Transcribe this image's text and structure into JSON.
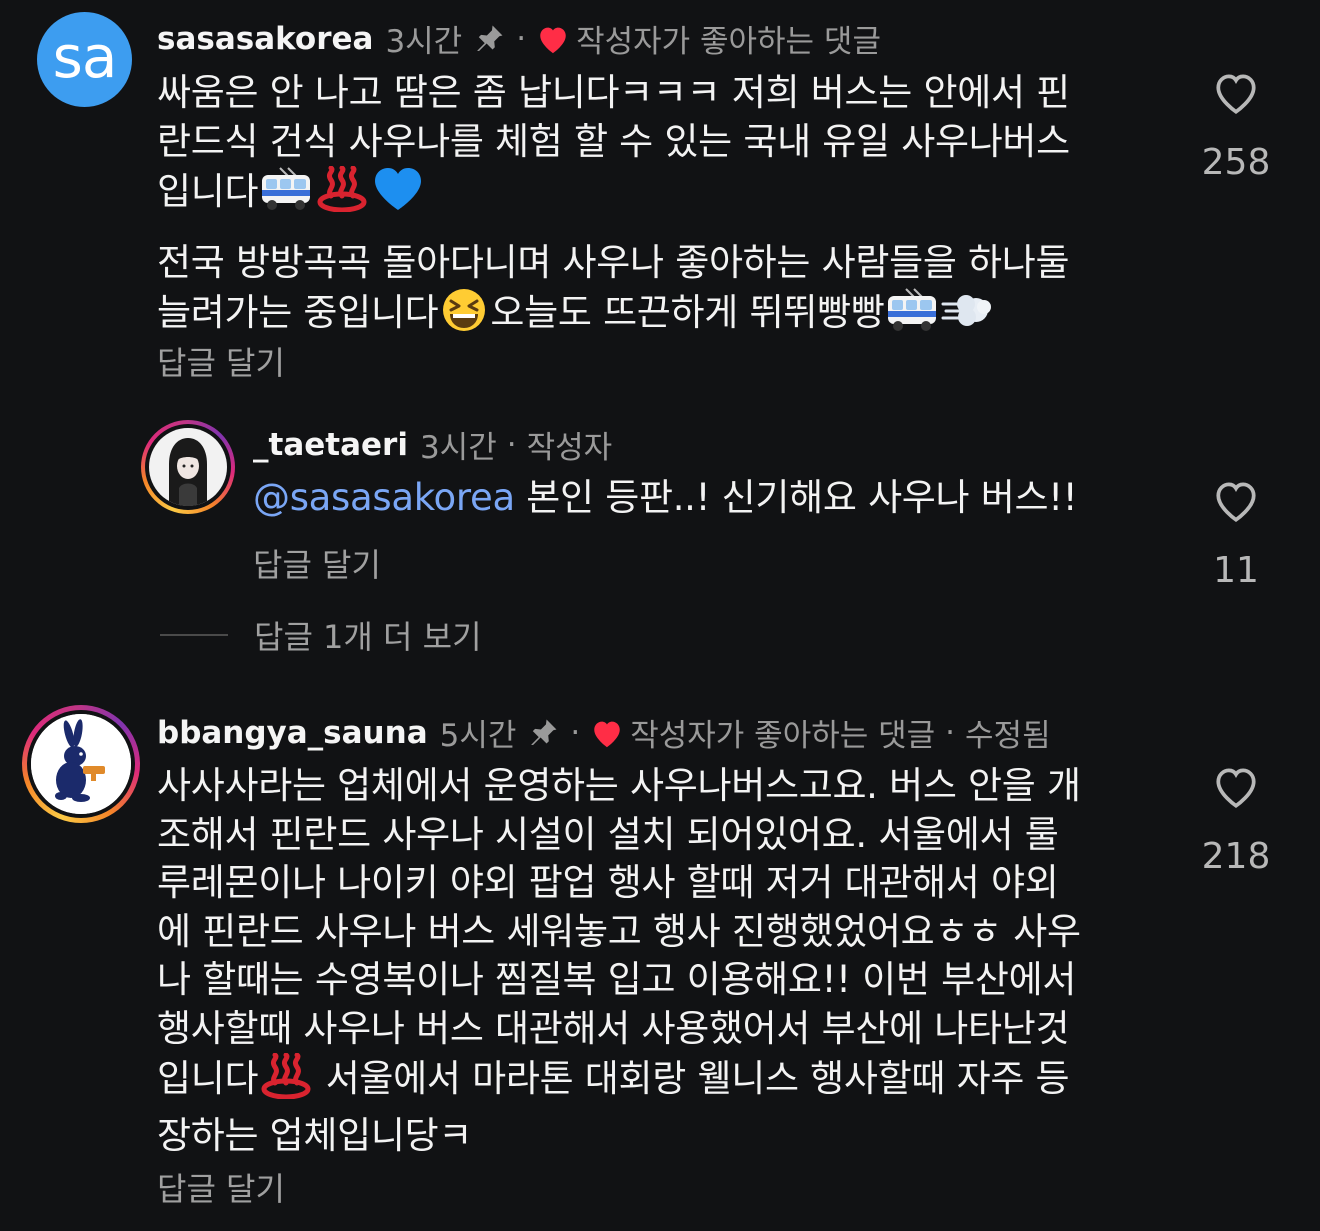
{
  "comments": [
    {
      "username": "sasasakorea",
      "avatar_text": "sa",
      "time": "3시간",
      "pinned": true,
      "liked_label": "작성자가 좋아하는 댓글",
      "edited": "",
      "text_part1": "싸움은 안 나고 땀은 좀 납니다ㅋㅋㅋ 저희 버스는 안에서 핀\n란드식 건식 사우나를 체험 할 수 있는 국내 유일 사우나버스\n입니다",
      "text_part2": "전국 방방곡곡 돌아다니며 사우나 좋아하는 사람들을 하나둘\n늘려가는 중입니다",
      "text_part3": "오늘도 뜨끈하게 뛰뛰빵빵",
      "reply_label": "답글 달기",
      "like_count": "258"
    },
    {
      "username": "_taetaeri",
      "time": "3시간",
      "author_label": "작성자",
      "mention": "@sasasakorea",
      "text": " 본인 등판..! 신기해요 사우나 버스!!",
      "reply_label": "답글 달기",
      "like_count": "11"
    },
    {
      "username": "bbangya_sauna",
      "time": "5시간",
      "pinned": true,
      "liked_label": "작성자가 좋아하는 댓글",
      "edited": "수정됨",
      "text_part1": "사사사라는 업체에서 운영하는 사우나버스고요. 버스 안을 개\n조해서 핀란드 사우나 시설이 설치 되어있어요. 서울에서 룰\n루레몬이나 나이키 야외 팝업 행사 할때 저거 대관해서 야외\n에 핀란드 사우나 버스 세워놓고 행사 진행했었어요ㅎㅎ 사우\n나 할때는 수영복이나 찜질복 입고 이용해요!! 이번 부산에서\n행사할때 사우나 버스 대관해서 사용했어서 부산에 나타난것\n입니다",
      "text_part2": " 서울에서 마라톤 대회랑 웰니스 행사할때 자주 등\n장하는 업체입니당ㅋ",
      "reply_label": "답글 달기",
      "like_count": "218"
    }
  ],
  "more_replies_label": "답글 1개 더 보기",
  "colors": {
    "background": "#111214",
    "mention": "#7aa6f5",
    "heart_red": "#ff2d46",
    "avatar_blue": "#3d9df0"
  },
  "icons": [
    "pin-icon",
    "heart-icon",
    "heart-outline-icon",
    "trolleybus-emoji",
    "hot-springs-emoji",
    "blue-heart-emoji",
    "grinning-squinting-emoji",
    "dash-emoji"
  ]
}
